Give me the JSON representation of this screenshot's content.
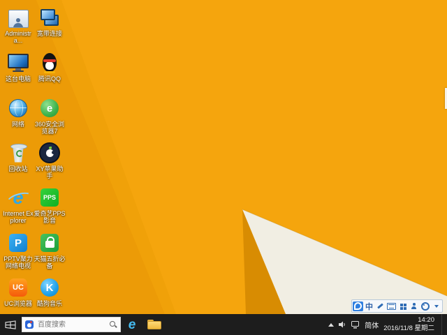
{
  "colors": {
    "wallpaper_base": "#F5A50D",
    "wallpaper_left_shade": "#EC9B07",
    "wallpaper_fold_dark": "#D88C02",
    "wallpaper_fold_light": "#F1EEE3",
    "taskbar": "#1d1d1d"
  },
  "desktop": {
    "icons": [
      {
        "name": "administrator",
        "label": "Administra..."
      },
      {
        "name": "this-pc",
        "label": "这台电脑"
      },
      {
        "name": "network",
        "label": "网络"
      },
      {
        "name": "recycle-bin",
        "label": "回收站"
      },
      {
        "name": "internet-explorer",
        "label": "Internet Explorer",
        "glyph": "e"
      },
      {
        "name": "pptv",
        "label": "PPTV聚力网络电视",
        "glyph": "P"
      },
      {
        "name": "uc-browser",
        "label": "UC浏览器",
        "glyph": "UC"
      },
      {
        "name": "broadband-connection",
        "label": "宽带连接"
      },
      {
        "name": "tencent-qq",
        "label": "腾讯QQ"
      },
      {
        "name": "360-secure-browser",
        "label": "360安全浏览器7",
        "glyph": "e"
      },
      {
        "name": "xy-apple-assistant",
        "label": "XY苹果助手"
      },
      {
        "name": "iqiyi-pps",
        "label": "爱奇艺PPS影音",
        "glyph": "PPS"
      },
      {
        "name": "tmall-half-price",
        "label": "天猫五折必备"
      },
      {
        "name": "kugou-music",
        "label": "酷狗音乐",
        "glyph": "K"
      }
    ]
  },
  "taskbar": {
    "search": {
      "placeholder": "百度搜索"
    },
    "tray": {
      "language_indicator": "简体",
      "time": "14:20",
      "date": "2016/11/8 星期二"
    }
  },
  "ime_bar": {
    "language_glyph": "中"
  }
}
